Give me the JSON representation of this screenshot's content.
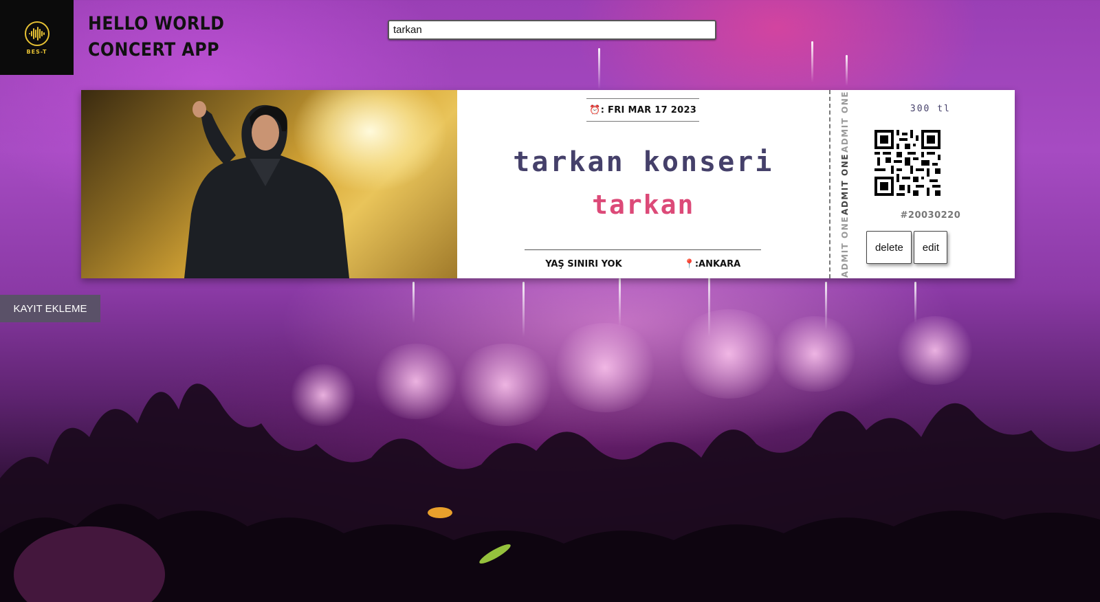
{
  "brand": {
    "logo_text": "BES-T",
    "title_line1": "HELLO WORLD",
    "title_line2": "CONCERT APP",
    "accent_color": "#e7c234"
  },
  "search": {
    "value": "tarkan",
    "icon": "search-input"
  },
  "sidebar": {
    "add_label": "KAYIT EKLEME"
  },
  "ticket": {
    "date_icon": "⏰",
    "date": ": FRI MAR 17 2023",
    "title": "tarkan konseri",
    "artist": "tarkan",
    "age_limit": "YAŞ SINIRI YOK",
    "location_icon": "📍",
    "location": ":ANKARA",
    "admit_label": "ADMIT ONE",
    "price": "300 tl",
    "serial": "#20030220",
    "delete_label": "delete",
    "edit_label": "edit",
    "title_color": "#45406a",
    "artist_color": "#dc4a78"
  }
}
